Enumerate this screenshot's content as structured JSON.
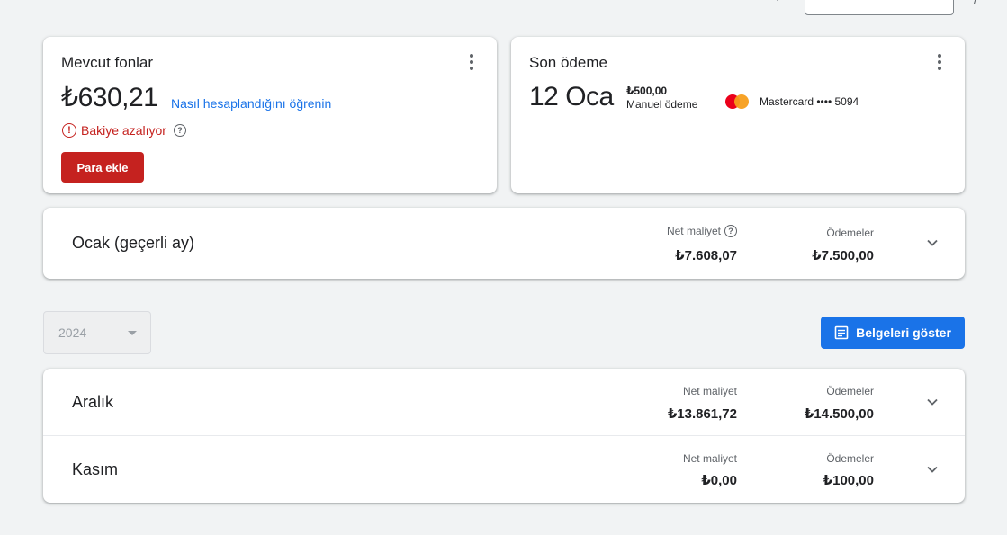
{
  "funds_card": {
    "title": "Mevcut fonlar",
    "amount": "₺630,21",
    "learn_link": "Nasıl hesaplandığını öğrenin",
    "warning": "Bakiye azalıyor",
    "add_button": "Para ekle"
  },
  "payment_card": {
    "title": "Son ödeme",
    "date": "12 Oca",
    "amount": "₺500,00",
    "method": "Manuel ödeme",
    "card_label": "Mastercard •••• 5094"
  },
  "current_month": {
    "title": "Ocak (geçerli ay)",
    "net_cost_label": "Net maliyet",
    "net_cost": "₺7.608,07",
    "payments_label": "Ödemeler",
    "payments": "₺7.500,00"
  },
  "year_select": {
    "value": "2024"
  },
  "show_docs_button": "Belgeleri göster",
  "months": [
    {
      "title": "Aralık",
      "net_cost_label": "Net maliyet",
      "net_cost": "₺13.861,72",
      "payments_label": "Ödemeler",
      "payments": "₺14.500,00"
    },
    {
      "title": "Kasım",
      "net_cost_label": "Net maliyet",
      "net_cost": "₺0,00",
      "payments_label": "Ödemeler",
      "payments": "₺100,00"
    }
  ],
  "colors": {
    "accent": "#1a73e8",
    "danger": "#c5221f",
    "background": "#f1f3f4"
  }
}
